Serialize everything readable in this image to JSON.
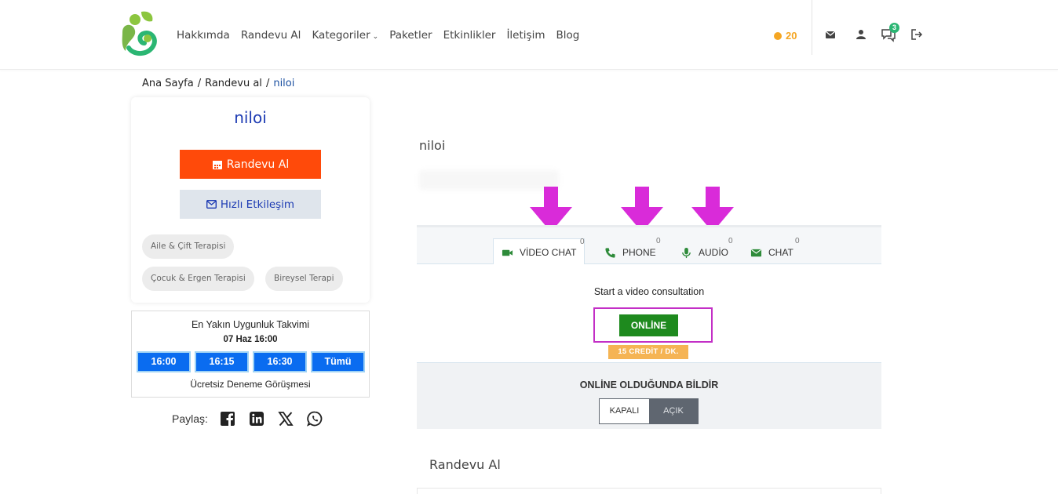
{
  "nav": {
    "items": [
      "Hakkımda",
      "Randevu Al",
      "Kategoriler",
      "Paketler",
      "Etkinlikler",
      "İletişim",
      "Blog"
    ],
    "credits": "20",
    "message_badge": "3"
  },
  "breadcrumb": {
    "home": "Ana Sayfa",
    "sep": "/",
    "section": "Randevu al",
    "current": "niloi"
  },
  "profile": {
    "name": "niloi",
    "appointment_button": "Randevu Al",
    "quick_button": "Hızlı Etkileşim",
    "tags": [
      "Aile & Çift Terapisi",
      "Çocuk & Ergen Terapisi",
      "Bireysel Terapi"
    ]
  },
  "availability": {
    "title": "En Yakın Uygunluk Takvimi",
    "date": "07 Haz 16:00",
    "slots": [
      "16:00",
      "16:15",
      "16:30",
      "Tümü"
    ],
    "note": "Ücretsiz Deneme Görüşmesi"
  },
  "share": {
    "label": "Paylaş:"
  },
  "main": {
    "title": "niloi",
    "tabs": [
      {
        "label": "VİDEO CHAT",
        "count": "0"
      },
      {
        "label": "PHONE",
        "count": "0"
      },
      {
        "label": "AUDİO",
        "count": "0"
      },
      {
        "label": "CHAT",
        "count": "0"
      }
    ],
    "consult_text": "Start a video consultation",
    "online_button": "ONLİNE",
    "credit_rate": "15 CREDİT / DK.",
    "notify_label": "ONLİNE OLDUĞUNDA BİLDİR",
    "toggle_off": "KAPALI",
    "toggle_on": "AÇIK",
    "appointment_section": "Randevu Al"
  },
  "colors": {
    "accent_orange": "#ff4a0a",
    "brand_blue": "#1d3bb3",
    "online_green": "#1e8a1e",
    "annotation_magenta": "#d92bd9",
    "credit_yellow": "#f5a623"
  }
}
